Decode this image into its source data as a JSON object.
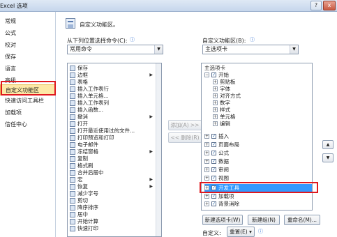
{
  "window": {
    "title": "Excel 选项",
    "help_glyph": "?",
    "close_glyph": "x"
  },
  "nav": {
    "items": [
      {
        "label": "常规"
      },
      {
        "label": "公式"
      },
      {
        "label": "校对"
      },
      {
        "label": "保存"
      },
      {
        "label": "语言"
      },
      {
        "label": "高级"
      },
      {
        "label": "自定义功能区",
        "selected": true
      },
      {
        "label": "快速访问工具栏"
      },
      {
        "label": "加载项"
      },
      {
        "label": "信任中心"
      }
    ]
  },
  "header": {
    "title": "自定义功能区。"
  },
  "left_panel": {
    "label": "从下列位置选择命令(C):",
    "combo_value": "常用命令",
    "commands": [
      {
        "label": "保存",
        "icon": "save-icon"
      },
      {
        "label": "边框",
        "icon": "border-icon",
        "submenu": true
      },
      {
        "label": "表格",
        "icon": "table-icon"
      },
      {
        "label": "插入工作表行",
        "icon": "insert-row-icon"
      },
      {
        "label": "插入单元格...",
        "icon": "insert-cell-icon"
      },
      {
        "label": "插入工作表列",
        "icon": "insert-column-icon"
      },
      {
        "label": "插入函数...",
        "icon": "function-icon"
      },
      {
        "label": "撤消",
        "icon": "undo-icon",
        "submenu": true
      },
      {
        "label": "打开",
        "icon": "open-icon"
      },
      {
        "label": "打开最近使用过的文件...",
        "icon": "recent-file-icon"
      },
      {
        "label": "打印预览和打印",
        "icon": "print-preview-icon"
      },
      {
        "label": "电子邮件",
        "icon": "email-icon"
      },
      {
        "label": "冻结窗格",
        "icon": "freeze-panes-icon",
        "submenu": true
      },
      {
        "label": "复制",
        "icon": "copy-icon"
      },
      {
        "label": "格式刷",
        "icon": "format-painter-icon"
      },
      {
        "label": "合并后居中",
        "icon": "merge-center-icon"
      },
      {
        "label": "宏",
        "icon": "macro-icon",
        "submenu": true
      },
      {
        "label": "恢复",
        "icon": "redo-icon",
        "submenu": true
      },
      {
        "label": "减少字号",
        "icon": "decrease-font-icon"
      },
      {
        "label": "剪切",
        "icon": "cut-icon"
      },
      {
        "label": "降序排序",
        "icon": "sort-desc-icon"
      },
      {
        "label": "居中",
        "icon": "center-icon"
      },
      {
        "label": "开始计算",
        "icon": "calculate-icon"
      },
      {
        "label": "快速打印",
        "icon": "quick-print-icon"
      }
    ]
  },
  "middle": {
    "add_label": "添加(A) >>",
    "remove_label": "<< 删除(R)"
  },
  "right_panel": {
    "label": "自定义功能区(B):",
    "combo_value": "主选项卡",
    "tree_header": "主选项卡",
    "tree": [
      {
        "label": "开始",
        "level": 0,
        "expander": "minus",
        "checked": true
      },
      {
        "label": "剪贴板",
        "level": 1,
        "expander": "plus"
      },
      {
        "label": "字体",
        "level": 1,
        "expander": "plus"
      },
      {
        "label": "对齐方式",
        "level": 1,
        "expander": "plus"
      },
      {
        "label": "数字",
        "level": 1,
        "expander": "plus"
      },
      {
        "label": "样式",
        "level": 1,
        "expander": "plus"
      },
      {
        "label": "单元格",
        "level": 1,
        "expander": "plus"
      },
      {
        "label": "编辑",
        "level": 1,
        "expander": "plus"
      },
      {
        "label": "插入",
        "level": 0,
        "expander": "plus",
        "checked": true
      },
      {
        "label": "页面布局",
        "level": 0,
        "expander": "plus",
        "checked": true
      },
      {
        "label": "公式",
        "level": 0,
        "expander": "plus",
        "checked": true
      },
      {
        "label": "数据",
        "level": 0,
        "expander": "plus",
        "checked": true
      },
      {
        "label": "审阅",
        "level": 0,
        "expander": "plus",
        "checked": true
      },
      {
        "label": "视图",
        "level": 0,
        "expander": "plus",
        "checked": true
      },
      {
        "label": "开发工具",
        "level": 0,
        "expander": "plus",
        "checked": true,
        "selected": true
      },
      {
        "label": "加载项",
        "level": 0,
        "expander": "plus",
        "checked": true
      },
      {
        "label": "背景消除",
        "level": 0,
        "expander": "plus",
        "checked": true
      }
    ],
    "new_tab_label": "新建选项卡(W)",
    "new_group_label": "新建组(N)",
    "rename_label": "重命名(M)...",
    "custom_label": "自定义:",
    "reset_label": "重置(E) ▾"
  },
  "colors": {
    "highlight_red": "#e0181e",
    "selection": "#3399ff",
    "nav_selected": "#fde8a6"
  }
}
